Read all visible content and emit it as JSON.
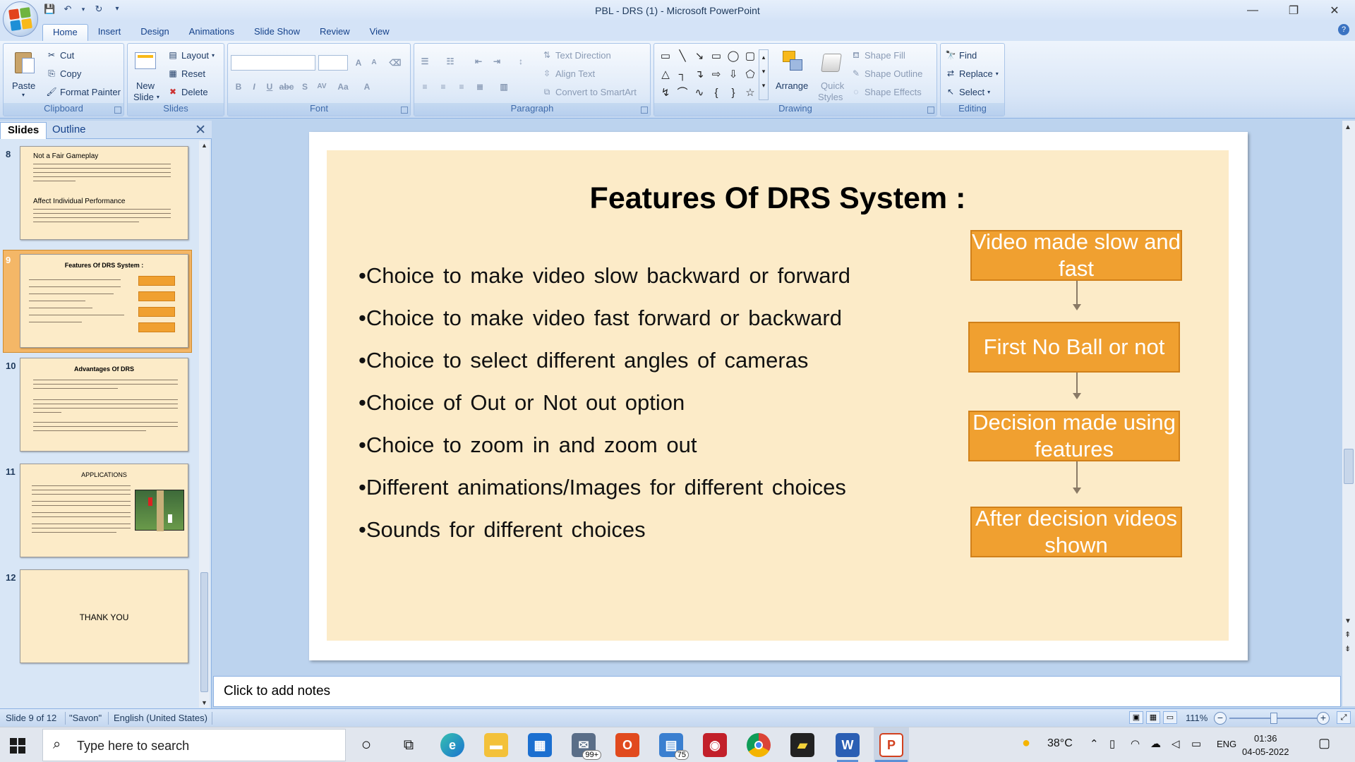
{
  "window": {
    "title": "PBL - DRS (1) - Microsoft PowerPoint"
  },
  "qat": {
    "undo_arrow": "▾"
  },
  "tabs": [
    {
      "label": "Home"
    },
    {
      "label": "Insert"
    },
    {
      "label": "Design"
    },
    {
      "label": "Animations"
    },
    {
      "label": "Slide Show"
    },
    {
      "label": "Review"
    },
    {
      "label": "View"
    }
  ],
  "ribbon": {
    "clipboard": {
      "label": "Clipboard",
      "paste": "Paste",
      "cut": "Cut",
      "copy": "Copy",
      "format_painter": "Format Painter"
    },
    "slides": {
      "label": "Slides",
      "new_slide_1": "New",
      "new_slide_2": "Slide",
      "layout": "Layout",
      "reset": "Reset",
      "delete": "Delete"
    },
    "font": {
      "label": "Font"
    },
    "paragraph": {
      "label": "Paragraph",
      "text_direction": "Text Direction",
      "align_text": "Align Text",
      "convert_smartart": "Convert to SmartArt"
    },
    "drawing": {
      "label": "Drawing",
      "arrange": "Arrange",
      "quick_styles_1": "Quick",
      "quick_styles_2": "Styles",
      "shape_fill": "Shape Fill",
      "shape_outline": "Shape Outline",
      "shape_effects": "Shape Effects"
    },
    "editing": {
      "label": "Editing",
      "find": "Find",
      "replace": "Replace",
      "select": "Select"
    }
  },
  "left_panel": {
    "tab_slides": "Slides",
    "tab_outline": "Outline",
    "thumbnails": [
      {
        "num": "8",
        "title": "Not a Fair Gameplay",
        "subtitle": "Affect Individual Performance"
      },
      {
        "num": "9",
        "title": "Features Of DRS System :"
      },
      {
        "num": "10",
        "title": "Advantages Of DRS"
      },
      {
        "num": "11",
        "title": "APPLICATIONS"
      },
      {
        "num": "12",
        "title": "THANK YOU"
      }
    ]
  },
  "slide": {
    "title": "Features Of DRS System :",
    "bullets": [
      "•Choice to make video slow backward or forward",
      "•Choice to make video fast forward or backward",
      "•Choice to select different angles of cameras",
      "•Choice of Out or Not out option",
      "•Choice to zoom in and zoom out",
      "•Different animations/Images for different choices",
      "•Sounds for different choices"
    ],
    "flow": [
      "Video made slow and fast",
      "First No Ball or not",
      "Decision made using features",
      "After decision videos shown"
    ]
  },
  "notes": {
    "placeholder": "Click to add notes"
  },
  "status": {
    "slide": "Slide 9 of 12",
    "theme": "\"Savon\"",
    "language": "English (United States)",
    "zoom": "111%"
  },
  "taskbar": {
    "search_placeholder": "Type here to search",
    "mail_badge": "99+",
    "files_badge": "75",
    "weather": "38°C",
    "lang": "ENG",
    "time": "01:36",
    "date": "04-05-2022"
  },
  "colors": {
    "accent": "#f0a030",
    "slide_bg": "#fcebc8",
    "ribbon": "#d4e3f7"
  }
}
